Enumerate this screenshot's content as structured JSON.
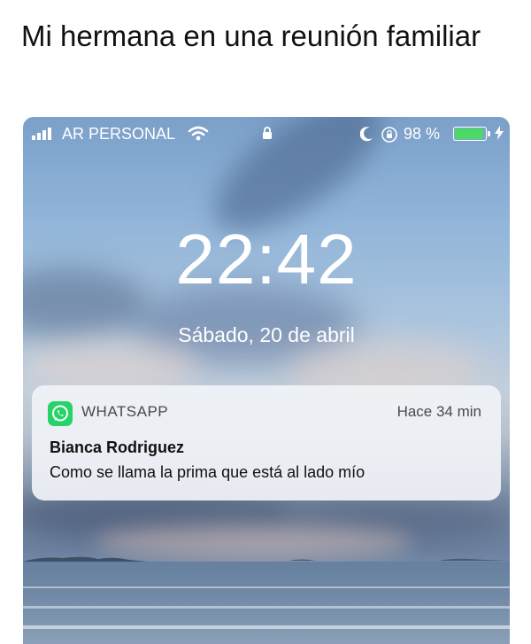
{
  "caption": "Mi hermana en una reunión familiar",
  "status_bar": {
    "carrier": "AR PERSONAL",
    "battery_percent_text": "98 %",
    "battery_level": 0.98,
    "signal_icon": "signal-bars-icon",
    "wifi_icon": "wifi-icon",
    "lock_icon": "lock-icon",
    "moon_icon": "do-not-disturb-moon-icon",
    "rotation_lock_icon": "rotation-lock-icon",
    "charging_icon": "charging-bolt-icon",
    "battery_color": "#4cd964"
  },
  "lock_screen": {
    "time": "22:42",
    "date": "Sábado, 20 de abril"
  },
  "notification": {
    "app_icon": "whatsapp-icon",
    "app_name": "WHATSAPP",
    "time_ago": "Hace 34 min",
    "sender": "Bianca Rodriguez",
    "message": "Como se llama la prima que está al lado mío",
    "accent_color": "#25d366"
  }
}
